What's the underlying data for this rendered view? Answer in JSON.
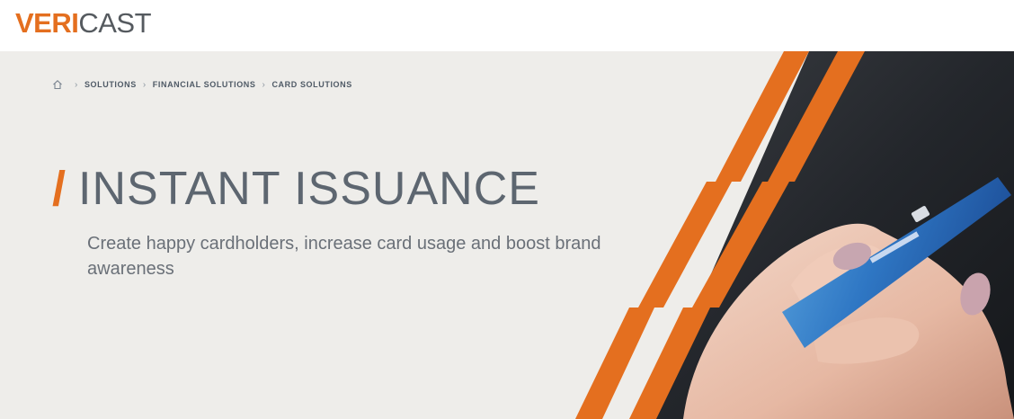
{
  "logo": {
    "text_bold": "VERI",
    "text_light": "CAST",
    "color_accent": "#e46f1f",
    "color_text": "#555a5f"
  },
  "breadcrumb": {
    "home_icon": "home-icon",
    "separator": "›",
    "items": [
      "SOLUTIONS",
      "FINANCIAL SOLUTIONS",
      "CARD SOLUTIONS"
    ]
  },
  "hero": {
    "title_slash": "/",
    "title": "INSTANT ISSUANCE",
    "subtitle": "Create happy cardholders, increase card usage and boost brand awareness",
    "accent_color": "#e46f1f",
    "background_color": "#eeedea"
  }
}
